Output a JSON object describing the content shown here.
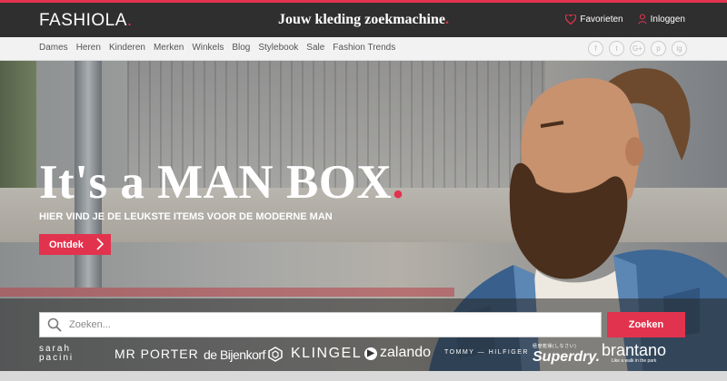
{
  "header": {
    "logo": "FASHIOLA",
    "logo_dot": ".",
    "tagline": "Jouw kleding zoekmachine",
    "tagline_dot": ".",
    "favorites_label": "Favorieten",
    "login_label": "Inloggen"
  },
  "nav": {
    "items": [
      "Dames",
      "Heren",
      "Kinderen",
      "Merken",
      "Winkels",
      "Blog",
      "Stylebook",
      "Sale",
      "Fashion Trends"
    ]
  },
  "socials": [
    "f",
    "t",
    "G+",
    "p",
    "ig"
  ],
  "hero": {
    "headline": "It's a MAN BOX",
    "headline_dot": ".",
    "subline": "HIER VIND JE DE LEUKSTE ITEMS VOOR DE MODERNE MAN",
    "cta_label": "Ontdek"
  },
  "search": {
    "placeholder": "Zoeken...",
    "button_label": "Zoeken"
  },
  "brands": {
    "sarah_pacini": [
      "sarah",
      "pacini"
    ],
    "mr_porter": "MR PORTER",
    "bijenkorf": "de Bijenkorf",
    "klingel": "KLINGEL",
    "zalando": "zalando",
    "hilfiger": "TOMMY — HILFIGER",
    "superdry": "Superdry.",
    "superdry_sub": "極度乾燥(しなさい)",
    "brantano": "brantano",
    "brantano_sub": "Like a walk in the park"
  },
  "colors": {
    "accent": "#e2334e",
    "topbar": "#2f2f2f",
    "navbar": "#f2f2f2"
  },
  "icons": {
    "favorites": "heart-icon",
    "login": "user-icon",
    "search": "search-icon",
    "cta": "chevron-right-icon"
  }
}
